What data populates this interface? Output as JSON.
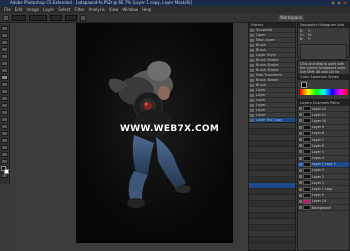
{
  "window": {
    "title": "Adobe Photoshop CS Extended - [adapaaod-fe.PSD @ 66.7% (Layer 1 copy, Layer Mask/8)]"
  },
  "menu": [
    "File",
    "Edit",
    "Image",
    "Layer",
    "Select",
    "Filter",
    "Analysis",
    "View",
    "Window",
    "Help"
  ],
  "optionsbar": {
    "workspace": "Workspace"
  },
  "watermark": "WWW.WEB7X.COM",
  "history": {
    "title": "History",
    "items": [
      "Snapshot",
      "Open",
      "New Layer",
      "Brush",
      "Brush",
      "Layer Style",
      "Brush Stroke",
      "Brush Stroke",
      "Brush Stroke",
      "Free Transform",
      "Brush Stroke",
      "Brush",
      "Layer",
      "Layer",
      "Layer",
      "Layer",
      "Layer",
      "Layer",
      "Layer Via Copy",
      "Brush Tool"
    ]
  },
  "info": {
    "title": "Navigator  Histogram  Info",
    "lines": [
      "R:",
      "G:",
      "B:",
      "C:",
      "M:",
      "Y:"
    ]
  },
  "nav_note": "Click and drag to paint with the current foreground color. Use Shift, Alt and Ctrl for additional options.",
  "color": {
    "title": "Color  Swatches  Styles"
  },
  "layers": {
    "title": "Layers  Channels  Paths",
    "items": [
      "Layer 12",
      "Layer 11",
      "Layer 10",
      "Layer 9",
      "Layer 8",
      "Layer 7",
      "Layer 6",
      "Layer 5",
      "Layer 4",
      "Layer 1 copy 2",
      "Layer 3",
      "Layer 2",
      "Layer 1",
      "Layer 1 copy",
      "Layer 0",
      "Layer 14",
      "Background"
    ]
  }
}
